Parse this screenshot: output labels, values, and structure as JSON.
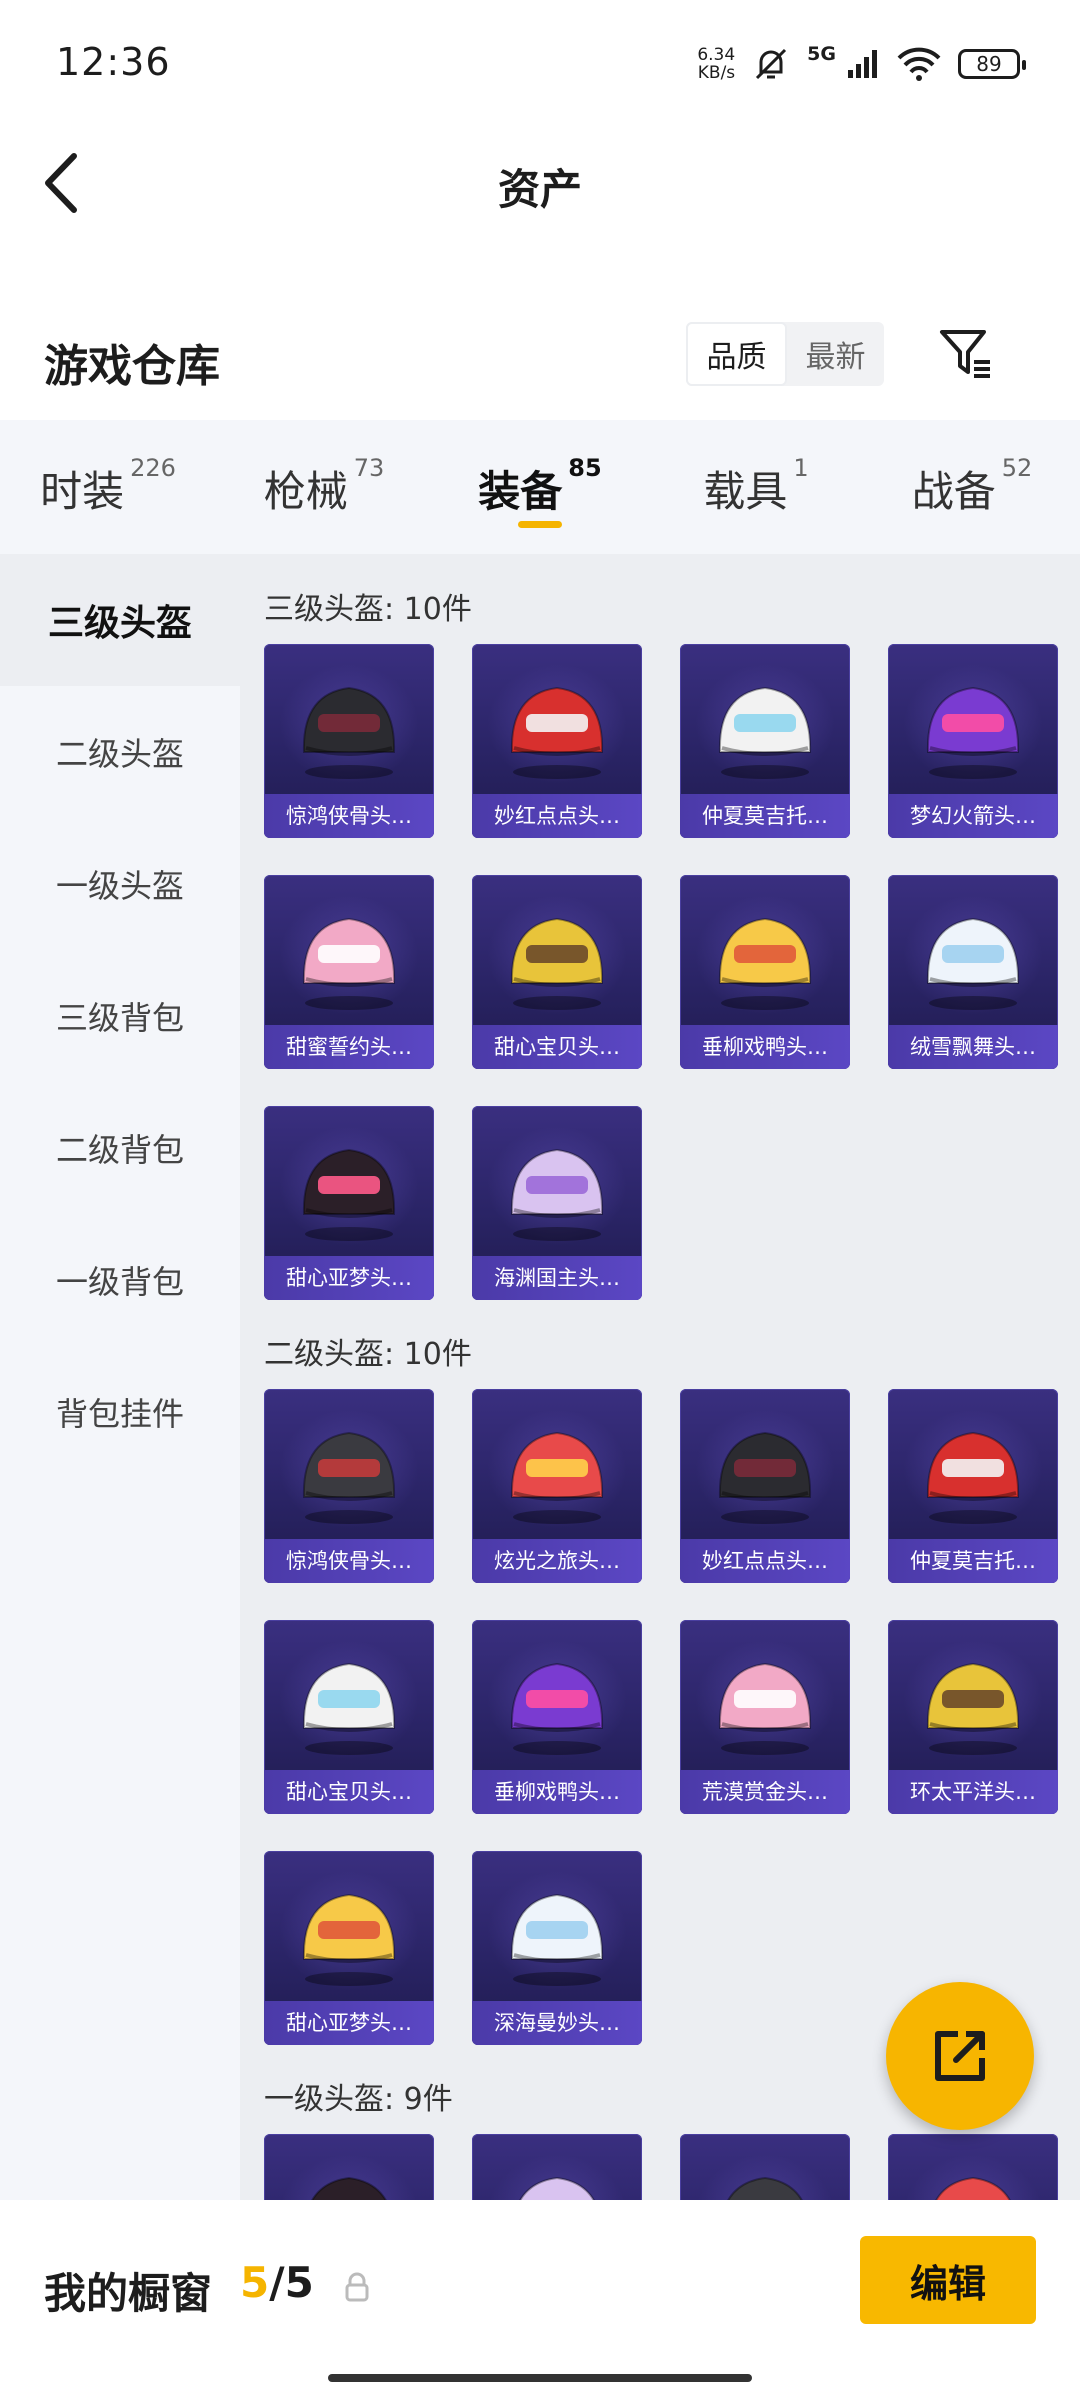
{
  "status": {
    "time": "12:36",
    "net_speed_value": "6.34",
    "net_speed_unit": "KB/s",
    "network": "5G",
    "wifi_sub": "7",
    "battery": "89"
  },
  "header": {
    "title": "资产",
    "back_icon": "chevron-left-icon"
  },
  "warehouse": {
    "title": "游戏仓库",
    "sort_options": [
      "品质",
      "最新"
    ],
    "active_sort": "品质",
    "filter_icon": "filter-icon"
  },
  "category_tabs": [
    {
      "label": "时装",
      "count": "226"
    },
    {
      "label": "枪械",
      "count": "73"
    },
    {
      "label": "装备",
      "count": "85",
      "active": true
    },
    {
      "label": "载具",
      "count": "1"
    },
    {
      "label": "战备",
      "count": "52"
    }
  ],
  "sidebar": {
    "items": [
      "三级头盔",
      "二级头盔",
      "一级头盔",
      "三级背包",
      "二级背包",
      "一级背包",
      "背包挂件"
    ],
    "active": "三级头盔"
  },
  "sections": [
    {
      "title": "三级头盔: 10件",
      "items": [
        "惊鸿侠骨头…",
        "妙红点点头…",
        "仲夏莫吉托…",
        "梦幻火箭头…",
        "甜蜜誓约头…",
        "甜心宝贝头…",
        "垂柳戏鸭头…",
        "绒雪飘舞头…",
        "甜心亚梦头…",
        "海渊国主头…"
      ]
    },
    {
      "title": "二级头盔: 10件",
      "items": [
        "惊鸿侠骨头…",
        "炫光之旅头…",
        "妙红点点头…",
        "仲夏莫吉托…",
        "甜心宝贝头…",
        "垂柳戏鸭头…",
        "荒漠赏金头…",
        "环太平洋头…",
        "甜心亚梦头…",
        "深海曼妙头…"
      ]
    },
    {
      "title": "一级头盔: 9件",
      "items": [
        "",
        "",
        "",
        ""
      ]
    }
  ],
  "showcase": {
    "title": "我的橱窗",
    "current": "5",
    "total": "5",
    "edit_label": "编辑"
  },
  "colors": {
    "accent": "#f5b400",
    "card_bg": "#2a2466",
    "label_bg": "#5b47c4"
  }
}
